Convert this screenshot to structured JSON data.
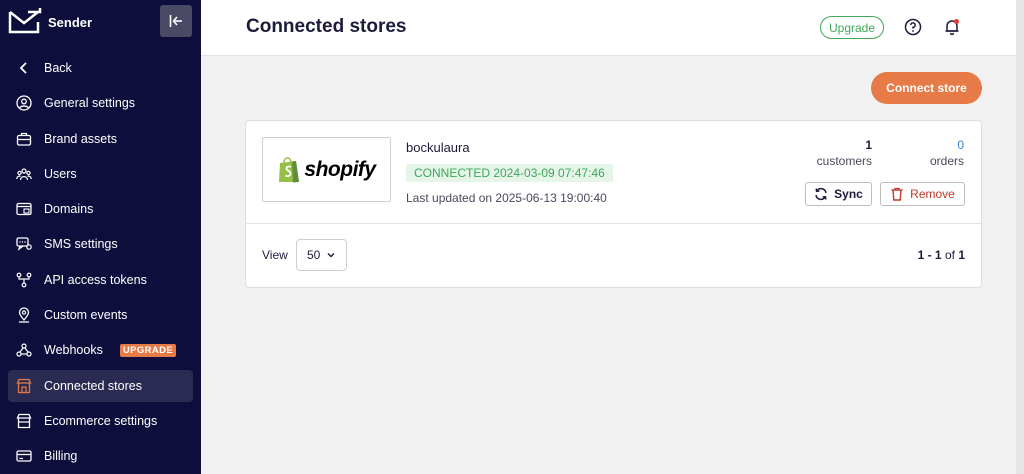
{
  "app": {
    "name": "Sender"
  },
  "sidebar": {
    "items": [
      {
        "label": "Back",
        "icon": "chevron-left-icon"
      },
      {
        "label": "General settings",
        "icon": "user-circle-icon"
      },
      {
        "label": "Brand assets",
        "icon": "briefcase-icon"
      },
      {
        "label": "Users",
        "icon": "users-icon"
      },
      {
        "label": "Domains",
        "icon": "domain-icon"
      },
      {
        "label": "SMS settings",
        "icon": "sms-icon"
      },
      {
        "label": "API access tokens",
        "icon": "api-icon"
      },
      {
        "label": "Custom events",
        "icon": "pin-icon"
      },
      {
        "label": "Webhooks",
        "icon": "webhook-icon",
        "badge": "UPGRADE"
      },
      {
        "label": "Connected stores",
        "icon": "store-icon",
        "active": true
      },
      {
        "label": "Ecommerce settings",
        "icon": "storefront-icon"
      },
      {
        "label": "Billing",
        "icon": "credit-card-icon"
      }
    ]
  },
  "header": {
    "title": "Connected stores",
    "upgrade_label": "Upgrade"
  },
  "actions": {
    "connect_label": "Connect store"
  },
  "store": {
    "platform": "shopify",
    "name": "bockulaura",
    "status": "CONNECTED 2024-03-09 07:47:46",
    "last_updated": "Last updated on 2025-06-13 19:00:40",
    "customers_value": "1",
    "customers_label": "customers",
    "orders_value": "0",
    "orders_label": "orders",
    "sync_label": "Sync",
    "remove_label": "Remove"
  },
  "footer": {
    "view_label": "View",
    "per_page": "50",
    "range": "1 - 1",
    "of_label": "of",
    "total": "1"
  },
  "colors": {
    "sidebar_bg": "#0e0e3c",
    "accent_orange": "#e77b48",
    "upgrade_green": "#42a85a",
    "connected_green": "#3fa55b",
    "remove_red": "#c0392b",
    "link_blue": "#3b7dd8"
  }
}
